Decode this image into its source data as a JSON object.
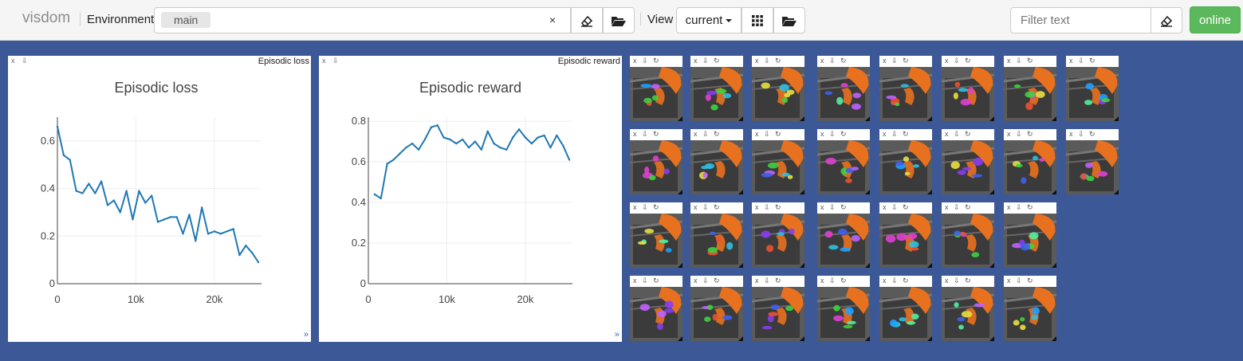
{
  "app": {
    "brand": "visdom"
  },
  "toolbar": {
    "environment_label": "Environment",
    "environment_selected": "main",
    "clear_symbol": "×",
    "view_label": "View",
    "view_selected": "current",
    "filter_placeholder": "Filter text",
    "online_label": "online",
    "icons": [
      "eraser-icon",
      "folder-open-icon",
      "grid-icon",
      "folder-open-icon",
      "eraser-icon"
    ]
  },
  "panes": {
    "controls": {
      "close": "x",
      "download": "⇩",
      "resize": "»"
    },
    "loss": {
      "window_title": "Episodic loss",
      "chart_title": "Episodic loss",
      "x_ticks": [
        "0",
        "10k",
        "20k"
      ],
      "y_ticks": [
        "0",
        "0.2",
        "0.4",
        "0.6"
      ]
    },
    "reward": {
      "window_title": "Episodic reward",
      "chart_title": "Episodic reward",
      "x_ticks": [
        "0",
        "10k",
        "20k"
      ],
      "y_ticks": [
        "0",
        "0.2",
        "0.4",
        "0.6",
        "0.8"
      ]
    }
  },
  "image_panes": {
    "controls": "x ⇩ ↻",
    "rows": [
      8,
      8,
      7,
      7
    ],
    "colors": {
      "robot_arm": "#e8711f",
      "bin": "#3b3b3b",
      "background": "#5a5a5a"
    }
  },
  "chart_data": [
    {
      "type": "line",
      "title": "Episodic loss",
      "xlim": [
        0,
        26000
      ],
      "ylim": [
        0,
        0.7
      ],
      "grid": true,
      "color": "#1f77b4",
      "x": [
        0,
        800,
        1600,
        2400,
        3200,
        4000,
        4800,
        5600,
        6400,
        7200,
        8000,
        8800,
        9600,
        10400,
        11200,
        12000,
        12800,
        13600,
        14400,
        15200,
        16000,
        16800,
        17600,
        18400,
        19200,
        20000,
        20800,
        21600,
        22400,
        23200,
        24000,
        24800,
        25600
      ],
      "y": [
        0.66,
        0.54,
        0.52,
        0.39,
        0.38,
        0.42,
        0.38,
        0.43,
        0.33,
        0.35,
        0.3,
        0.39,
        0.27,
        0.39,
        0.34,
        0.37,
        0.26,
        0.27,
        0.28,
        0.28,
        0.21,
        0.29,
        0.18,
        0.32,
        0.21,
        0.22,
        0.21,
        0.22,
        0.23,
        0.12,
        0.16,
        0.13,
        0.09
      ]
    },
    {
      "type": "line",
      "title": "Episodic reward",
      "xlim": [
        0,
        26000
      ],
      "ylim": [
        0,
        0.82
      ],
      "grid": true,
      "color": "#1f77b4",
      "x": [
        800,
        1600,
        2400,
        3200,
        4000,
        4800,
        5600,
        6400,
        7200,
        8000,
        8800,
        9600,
        10400,
        11200,
        12000,
        12800,
        13600,
        14400,
        15200,
        16000,
        16800,
        17600,
        18400,
        19200,
        20000,
        20800,
        21600,
        22400,
        23200,
        24000,
        24800,
        25600
      ],
      "y": [
        0.44,
        0.42,
        0.59,
        0.61,
        0.64,
        0.67,
        0.69,
        0.66,
        0.71,
        0.77,
        0.78,
        0.72,
        0.71,
        0.69,
        0.71,
        0.67,
        0.7,
        0.66,
        0.75,
        0.69,
        0.67,
        0.66,
        0.72,
        0.76,
        0.72,
        0.69,
        0.72,
        0.73,
        0.67,
        0.73,
        0.68,
        0.61
      ]
    }
  ]
}
